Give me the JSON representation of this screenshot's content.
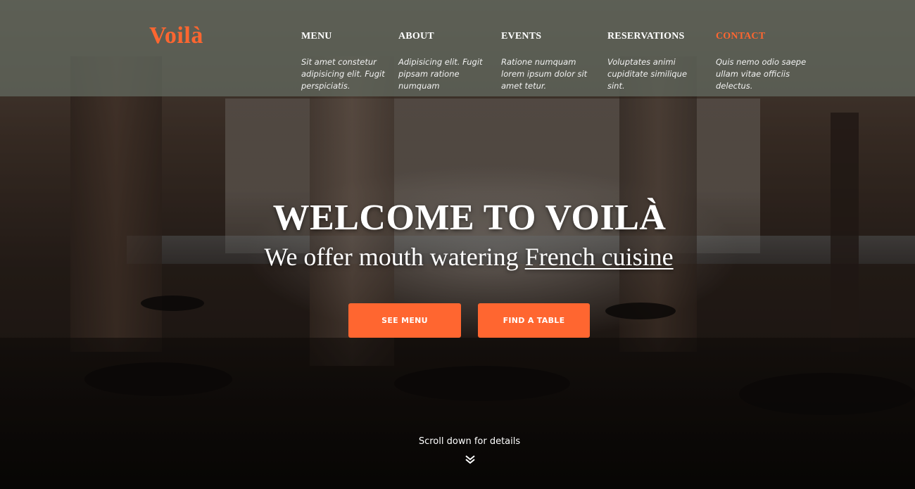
{
  "brand": {
    "logo": "Voilà",
    "accent_color": "#ff6630"
  },
  "nav": {
    "items": [
      {
        "label": "MENU",
        "description": "Sit amet constetur adipisicing elit. Fugit perspiciatis."
      },
      {
        "label": "ABOUT",
        "description": "Adipisicing elit. Fugit pipsam ratione numquam"
      },
      {
        "label": "EVENTS",
        "description": "Ratione numquam lorem ipsum dolor sit amet tetur."
      },
      {
        "label": "RESERVATIONS",
        "description": "Voluptates animi cupiditate similique sint."
      },
      {
        "label": "CONTACT",
        "description": "Quis nemo odio saepe ullam vitae officiis delectus.",
        "active": true
      }
    ]
  },
  "hero": {
    "heading": "WELCOME TO VOILÀ",
    "tagline_prefix": "We offer mouth watering ",
    "tagline_link": "French cuisine",
    "buttons": {
      "see_menu": "SEE MENU",
      "find_table": "FIND A TABLE"
    },
    "scroll_hint": "Scroll down for details",
    "scroll_icon": "double-chevron-down-icon"
  }
}
